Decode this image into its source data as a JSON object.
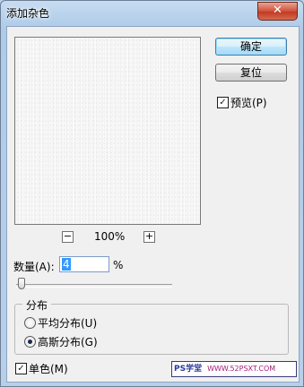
{
  "window": {
    "title": "添加杂色",
    "close_label": "✕"
  },
  "buttons": {
    "ok": "确定",
    "reset": "复位"
  },
  "preview": {
    "label": "预览(P)",
    "checked": true
  },
  "zoom": {
    "minus": "−",
    "plus": "+",
    "value": "100%"
  },
  "amount": {
    "label": "数量(A):",
    "value": "4",
    "unit": "%",
    "slider_fraction": 0.01
  },
  "distribution": {
    "legend": "分布",
    "options": [
      {
        "label": "平均分布(U)",
        "selected": false
      },
      {
        "label": "高斯分布(G)",
        "selected": true
      }
    ]
  },
  "monochrome": {
    "label": "单色(M)",
    "checked": true
  },
  "watermark": {
    "brand": "PS学堂",
    "url": "WWW.52PSXT.COM"
  },
  "colors": {
    "default_button_border": "#3c7fb1",
    "selection": "#3399ff"
  }
}
